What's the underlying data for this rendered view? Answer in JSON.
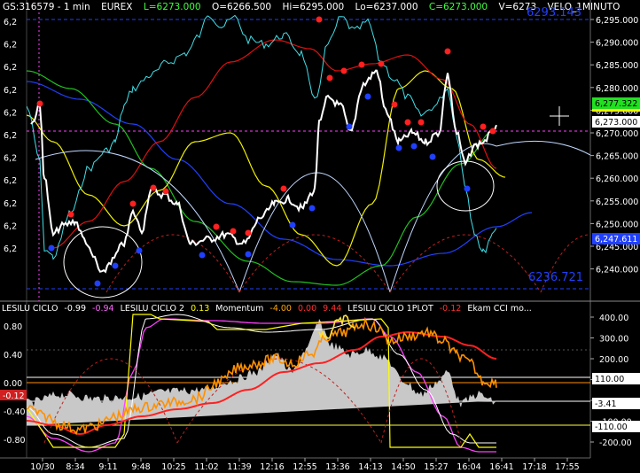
{
  "header": {
    "symbol": "GS:316579 - 1 min",
    "exchange": "EUREX",
    "low_label": "L=6273.000",
    "open_label": "O=6266.500",
    "high_label": "Hi=6295.000",
    "lo_label": "Lo=6237.000",
    "close_label": "C=6273.000",
    "volume_label": "V=6273",
    "study_label": "VELO_1MINUTO",
    "study_value": "6293.143"
  },
  "price_axis": {
    "ticks": [
      "6,295.000",
      "6,290.000",
      "6,285.000",
      "6,280.000",
      "6,275.000",
      "6,270.000",
      "6,265.000",
      "6,260.000",
      "6,255.000",
      "6,250.000",
      "6,245.000",
      "6,240.000"
    ],
    "left_ticks": [
      "6,2",
      "6,2",
      "6,2",
      "6,2",
      "6,2",
      "6,2",
      "6,2",
      "6,2",
      "6,2",
      "6,2",
      "6,2"
    ],
    "badge_green": "6,277.322",
    "badge_white": "6,273.000",
    "badge_blue": "6,247.611",
    "low_band_value": "6236.721"
  },
  "indicator": {
    "labels": [
      {
        "text": "LESILU CICLO",
        "color": "#ffffff"
      },
      {
        "text": "-0.99",
        "color": "#ffffff"
      },
      {
        "text": "-0.94",
        "color": "#ff66ff"
      },
      {
        "text": "LESILU CICLO 2",
        "color": "#ffffff"
      },
      {
        "text": "0.13",
        "color": "#ffff00"
      },
      {
        "text": "Momentum",
        "color": "#ffffff"
      },
      {
        "text": "-4.00",
        "color": "#ffa500"
      },
      {
        "text": "0.00",
        "color": "#ff3030"
      },
      {
        "text": "9.44",
        "color": "#ff3030"
      },
      {
        "text": "LESILU CICLO 1PLOT",
        "color": "#ffffff"
      },
      {
        "text": "-0.12",
        "color": "#ff3030"
      },
      {
        "text": "Ekam CCI mo...",
        "color": "#ffffff"
      }
    ],
    "left_ticks": [
      "0.80",
      "0.40",
      "0.00",
      "-0.40",
      "-0.80"
    ],
    "left_badge": "-0.12",
    "right_ticks": [
      "400.00",
      "300.00",
      "200.00",
      "100.00",
      "0.00",
      "-100.00",
      "-200.00"
    ],
    "badge_110": "110.00",
    "badge_341": "-3.41",
    "badge_m110": "-110.00"
  },
  "time_axis": [
    "10/30",
    "8:34",
    "9:11",
    "9:48",
    "10:25",
    "11:02",
    "11:39",
    "12:16",
    "12:55",
    "13:36",
    "14:13",
    "14:50",
    "15:27",
    "16:04",
    "16:41",
    "17:18",
    "17:55"
  ],
  "colors": {
    "price": "#ffffff",
    "cyan": "#40e0e8",
    "red_ma": "#e01010",
    "yellow_ma": "#f0f000",
    "green_ma": "#20c020",
    "blue_ma": "#2040ff",
    "magenta": "#ff40ff",
    "orange": "#ff9000",
    "gray_hist": "#c8c8c8"
  },
  "icons": {
    "crosshair": "crosshair-icon"
  }
}
